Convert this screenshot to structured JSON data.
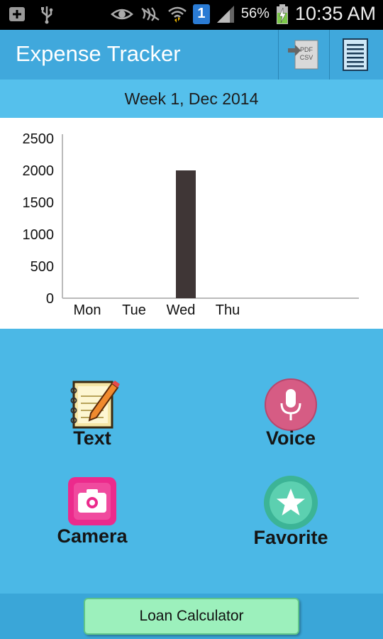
{
  "status_bar": {
    "battery_percent": "56%",
    "time": "10:35 AM",
    "notification_badge": "1"
  },
  "app": {
    "title": "Expense Tracker",
    "pdf_icon_line1": "PDF",
    "pdf_icon_line2": "CSV"
  },
  "week": {
    "label": "Week 1, Dec 2014"
  },
  "chart_data": {
    "type": "bar",
    "categories": [
      "Mon",
      "Tue",
      "Wed",
      "Thu"
    ],
    "values": [
      0,
      0,
      2000,
      0
    ],
    "title": "",
    "xlabel": "",
    "ylabel": "",
    "ylim": [
      0,
      2500
    ],
    "yticks": [
      0,
      500,
      1000,
      1500,
      2000,
      2500
    ],
    "bar_color": "#3f3636",
    "grid": false
  },
  "actions": {
    "text": "Text",
    "voice": "Voice",
    "camera": "Camera",
    "favorite": "Favorite"
  },
  "bottom": {
    "loan_calculator": "Loan Calculator"
  },
  "colors": {
    "background": "#4bb8e6",
    "actionbar": "#40a8dc",
    "loan_button": "#9cf0bc"
  }
}
